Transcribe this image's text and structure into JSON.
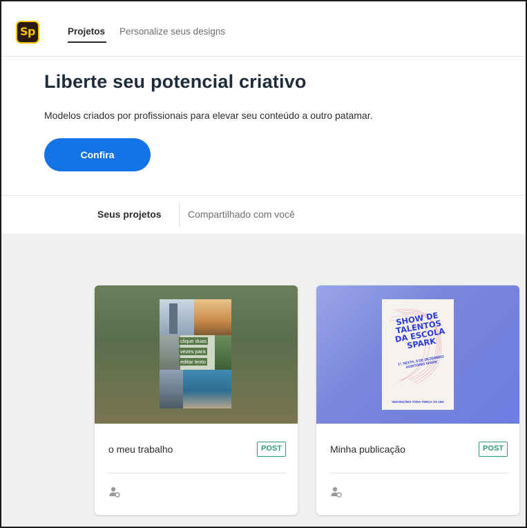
{
  "app": {
    "logo_text": "Sp",
    "brand_color": "#f6c400"
  },
  "nav": {
    "tabs": [
      {
        "label": "Projetos",
        "active": true
      },
      {
        "label": "Personalize seus designs",
        "active": false
      }
    ]
  },
  "hero": {
    "title": "Liberte seu potencial criativo",
    "subtitle": "Modelos criados por profissionais para elevar seu conteúdo a outro patamar.",
    "cta_label": "Confira",
    "cta_color": "#1473e6"
  },
  "project_tabs": [
    {
      "label": "Seus projetos",
      "active": true
    },
    {
      "label": "Compartilhado com você",
      "active": false
    }
  ],
  "projects": [
    {
      "title": "o meu trabalho",
      "badge": "POST",
      "thumbnail_text": [
        "clique duas",
        "vezes para",
        "editar texto"
      ],
      "owner_icon": "person-share-icon"
    },
    {
      "title": "Minha publicação",
      "badge": "POST",
      "thumbnail_text": [
        "SHOW DE TALENTOS DA ESCOLA SPARK",
        "1ª, SEXTA, 8 DE DEZEMBRO AUDITÓRIO SPARK",
        "INSCRIÇÕES TODA TERÇA ÀS 15H"
      ],
      "owner_icon": "person-share-icon"
    }
  ],
  "colors": {
    "badge_green": "#2d9d78",
    "heading": "#1d2b3a",
    "page_bg": "#f0f0f0"
  }
}
